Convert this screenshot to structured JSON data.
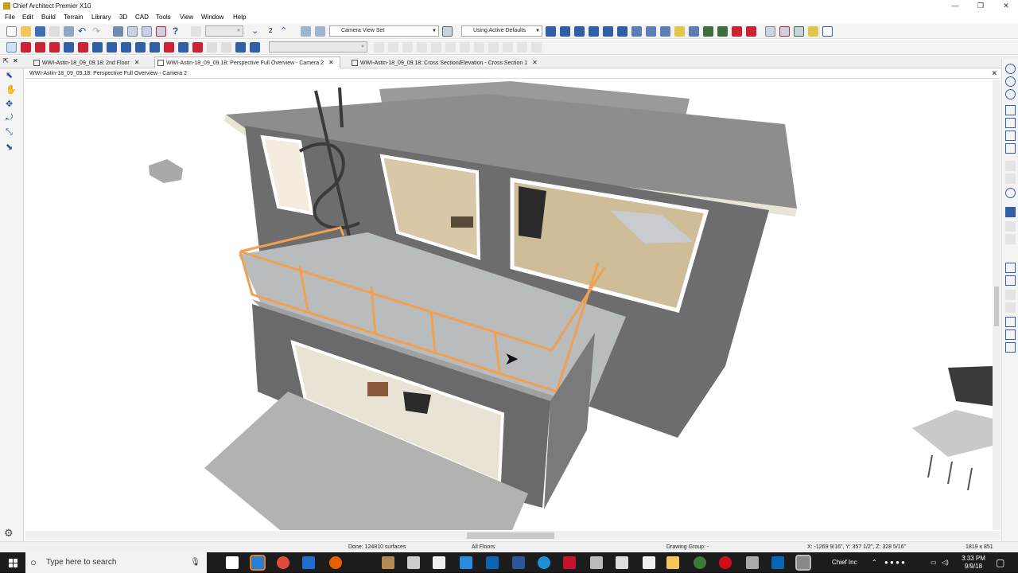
{
  "window": {
    "title": "Chief Architect Premier X10",
    "minimize": "—",
    "restore": "❐",
    "close": "✕"
  },
  "menu": [
    "File",
    "Edit",
    "Build",
    "Terrain",
    "Library",
    "3D",
    "CAD",
    "Tools",
    "View",
    "Window",
    "Help"
  ],
  "toolbar1": {
    "floor_number": "2",
    "camera_combo": "Camera View Set",
    "defaults_combo": "Using Active Defaults"
  },
  "tabs": [
    {
      "label": "WWI-Astin-18_09_09.18: 2nd Floor",
      "active": false
    },
    {
      "label": "WWI-Astin-18_09_09.18: Perspective Full Overview - Camera 2",
      "active": true
    },
    {
      "label": "WWI-Astin-18_09_09.18: Cross Section/Elevation - Cross Section 1",
      "active": false
    }
  ],
  "tab_close": "✕",
  "view": {
    "header": "WWI-Astin-18_09_09.18: Perspective Full Overview - Camera 2",
    "close": "✕"
  },
  "status": {
    "surfaces": "Done: 124810 surfaces",
    "floors": "All Floors",
    "drawing_group": "Drawing Group: -",
    "coords": "X: -1269 9/16\", Y: 357 1/2\", Z: 328 5/16\"",
    "size": "1819 x 851"
  },
  "taskbar": {
    "search_placeholder": "Type here to search",
    "tray_label": "Chief Inc",
    "time": "3:33 PM",
    "date": "9/9/18"
  },
  "colors": {
    "wall": "#6e6e6e",
    "roof": "#8b8b88",
    "railing": "#f0a050",
    "deck": "#b9bcbd",
    "taskbar": "#1c1c1c"
  }
}
